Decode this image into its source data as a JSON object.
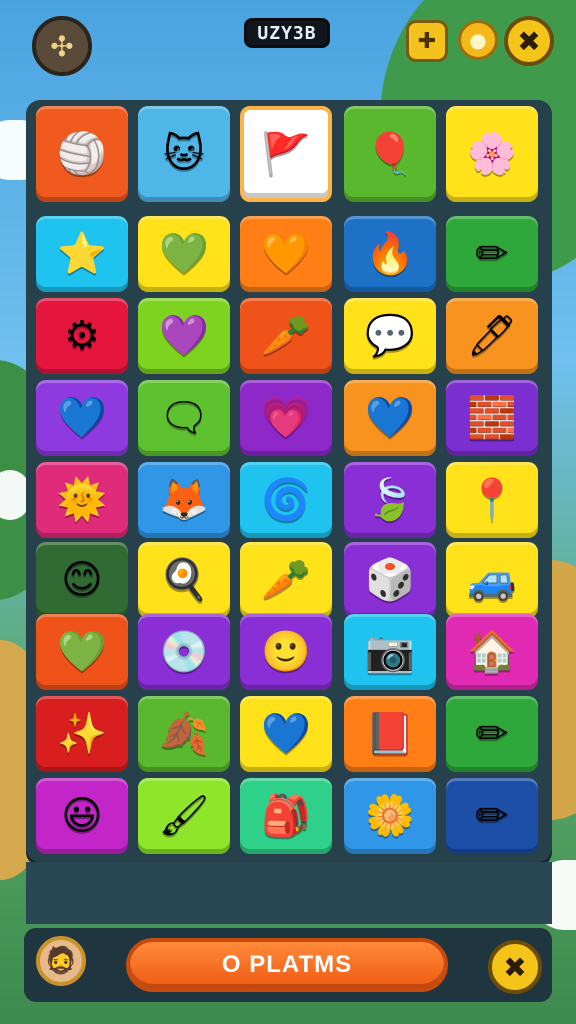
{
  "header": {
    "menu_icon": "puzzle-grid-icon",
    "menu_glyph": "✣",
    "score_text": "UZY3B",
    "puzzle_icon": "puzzle-piece-icon",
    "puzzle_glyph": "✚",
    "coin_icon": "coin-icon",
    "coin_glyph": "●",
    "close_icon": "close-icon",
    "close_glyph": "✖"
  },
  "colors": {
    "board": "#26404c",
    "accent": "#ef5a12",
    "gold": "#f5c419"
  },
  "tiles": [
    {
      "icon": "striped-ball-icon",
      "glyph": "🏐",
      "bg": "#f05a1e"
    },
    {
      "icon": "cat-robot-icon",
      "glyph": "🐱",
      "bg": "#4fb6e8"
    },
    {
      "icon": "flag-card-icon",
      "glyph": "🚩",
      "bg": "#ffffff"
    },
    {
      "icon": "sun-ball-icon",
      "glyph": "🎈",
      "bg": "#5ab82e"
    },
    {
      "icon": "flower-candy-icon",
      "glyph": "🌸",
      "bg": "#ffe21a"
    },
    {
      "icon": "starfish-icon",
      "glyph": "⭐",
      "bg": "#1ec3ef"
    },
    {
      "icon": "heart-icon",
      "glyph": "💚",
      "bg": "#ffe21a"
    },
    {
      "icon": "heart-icon",
      "glyph": "🧡",
      "bg": "#ff7f16"
    },
    {
      "icon": "flame-icon",
      "glyph": "🔥",
      "bg": "#1d72c8"
    },
    {
      "icon": "pencil-icon",
      "glyph": "✏",
      "bg": "#2ea83a"
    },
    {
      "icon": "gear-flower-icon",
      "glyph": "⚙",
      "bg": "#e5153e"
    },
    {
      "icon": "paint-splat-icon",
      "glyph": "💜",
      "bg": "#7ed321"
    },
    {
      "icon": "carrot-icon",
      "glyph": "🥕",
      "bg": "#f0531a"
    },
    {
      "icon": "speech-bubble-icon",
      "glyph": "💬",
      "bg": "#ffe21a"
    },
    {
      "icon": "pen-icon",
      "glyph": "🖊",
      "bg": "#f7931e"
    },
    {
      "icon": "heart-icon",
      "glyph": "💙",
      "bg": "#8e3ae0"
    },
    {
      "icon": "speech-bubble-icon",
      "glyph": "🗨",
      "bg": "#5ec12f"
    },
    {
      "icon": "heart-icon",
      "glyph": "💗",
      "bg": "#8e28c9"
    },
    {
      "icon": "heart-icon",
      "glyph": "💙",
      "bg": "#f7931e"
    },
    {
      "icon": "blocks-icon",
      "glyph": "🧱",
      "bg": "#7b2fd0"
    },
    {
      "icon": "sun-face-icon",
      "glyph": "🌞",
      "bg": "#e02a7a"
    },
    {
      "icon": "fox-icon",
      "glyph": "🦊",
      "bg": "#2f96e8"
    },
    {
      "icon": "swirl-icon",
      "glyph": "🌀",
      "bg": "#1ec3ef"
    },
    {
      "icon": "leaf-icon",
      "glyph": "🍃",
      "bg": "#8a2fd6"
    },
    {
      "icon": "pin-icon",
      "glyph": "📍",
      "bg": "#ffe21a"
    },
    {
      "icon": "blob-face-icon",
      "glyph": "😊",
      "bg": "#2f6b32"
    },
    {
      "icon": "egg-icon",
      "glyph": "🍳",
      "bg": "#ffe21a"
    },
    {
      "icon": "carrot-icon",
      "glyph": "🥕",
      "bg": "#ffe21a"
    },
    {
      "icon": "dice-icon",
      "glyph": "🎲",
      "bg": "#8a2fd6"
    },
    {
      "icon": "car-icon",
      "glyph": "🚙",
      "bg": "#ffe21a"
    },
    {
      "icon": "heart-icon",
      "glyph": "💚",
      "bg": "#f0531a"
    },
    {
      "icon": "disc-icon",
      "glyph": "💿",
      "bg": "#8a2fd6"
    },
    {
      "icon": "smiley-coin-icon",
      "glyph": "🙂",
      "bg": "#8a2fd6"
    },
    {
      "icon": "camera-icon",
      "glyph": "📷",
      "bg": "#1ec3ef"
    },
    {
      "icon": "house-icon",
      "glyph": "🏠",
      "bg": "#e02ab4"
    },
    {
      "icon": "star-card-icon",
      "glyph": "✨",
      "bg": "#d81e1e"
    },
    {
      "icon": "flame-leaf-icon",
      "glyph": "🍂",
      "bg": "#5ab82e"
    },
    {
      "icon": "heart-icon",
      "glyph": "💙",
      "bg": "#ffe21a"
    },
    {
      "icon": "book-icon",
      "glyph": "📕",
      "bg": "#ff7f16"
    },
    {
      "icon": "pencil-icon",
      "glyph": "✏",
      "bg": "#2ea83a"
    },
    {
      "icon": "smile-face-icon",
      "glyph": "😃",
      "bg": "#c325c9"
    },
    {
      "icon": "brush-icon",
      "glyph": "🖌",
      "bg": "#8ee52a"
    },
    {
      "icon": "backpack-icon",
      "glyph": "🎒",
      "bg": "#2fd18a"
    },
    {
      "icon": "flower-face-icon",
      "glyph": "🌼",
      "bg": "#2f96e8"
    },
    {
      "icon": "pencil-icon",
      "glyph": "✏",
      "bg": "#1d4ea8"
    }
  ],
  "footer": {
    "avatar_icon": "player-avatar-icon",
    "avatar_glyph": "🧔",
    "action_label": "O PLATMS",
    "close_icon": "close-icon",
    "close_glyph": "✖"
  }
}
